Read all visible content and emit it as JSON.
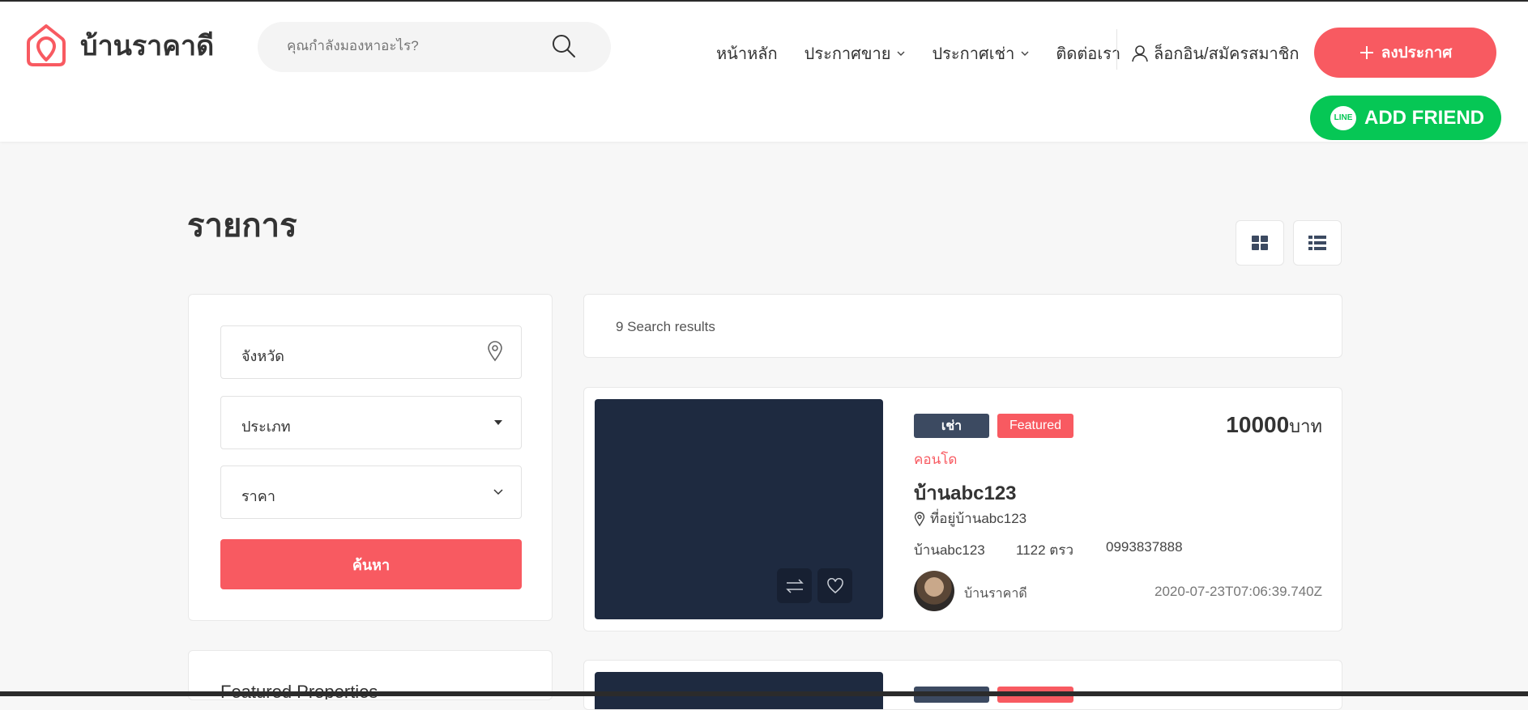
{
  "brand": {
    "name": "บ้านราคาดี",
    "accent": "#f85a61"
  },
  "search": {
    "placeholder": "คุณกำลังมองหาอะไร?"
  },
  "nav": {
    "home": "หน้าหลัก",
    "sale": "ประกาศขาย",
    "rent": "ประกาศเช่า",
    "contact": "ติดต่อเรา",
    "login": "ล็อกอิน/สมัครสมาชิก"
  },
  "actions": {
    "post": "ลงประกาศ",
    "line_add": "ADD FRIEND",
    "line_logo": "LINE"
  },
  "page": {
    "title": "รายการ"
  },
  "filters": {
    "province": "จังหวัด",
    "type": "ประเภท",
    "price": "ราคา",
    "submit": "ค้นหา"
  },
  "featured": {
    "title": "Featured Properties"
  },
  "results": {
    "summary": "9 Search results"
  },
  "listings": [
    {
      "badge_type": "เช่า",
      "badge_featured": "Featured",
      "price": "10000",
      "price_unit": "บาท",
      "property_type": "คอนโด",
      "title": "บ้านabc123",
      "address": "ที่อยู่บ้านabc123",
      "name": "บ้านabc123",
      "area": "1122 ตรว",
      "phone": "0993837888",
      "agent": "บ้านราคาดี",
      "date": "2020-07-23T07:06:39.740Z"
    }
  ],
  "icons": {
    "logo": "home-pin-icon",
    "search": "search-icon",
    "location": "location-pin-icon",
    "grid": "grid-view-icon",
    "list": "list-view-icon",
    "compare": "compare-icon",
    "favorite": "heart-icon"
  }
}
